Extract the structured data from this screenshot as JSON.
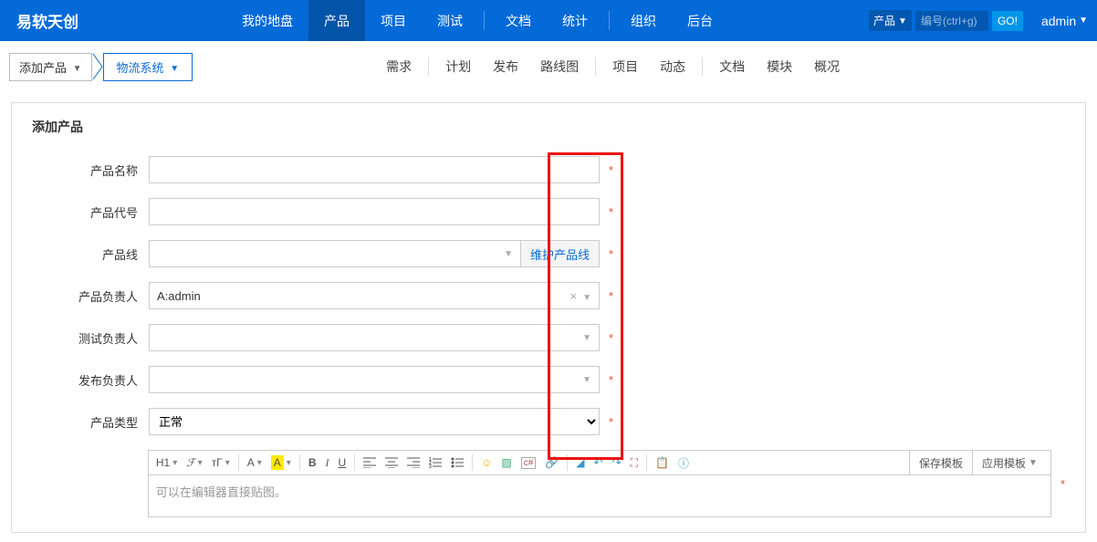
{
  "brand": "易软天创",
  "topnav": {
    "items": [
      {
        "label": "我的地盘",
        "active": false
      },
      {
        "label": "产品",
        "active": true
      },
      {
        "label": "项目",
        "active": false
      },
      {
        "label": "测试",
        "active": false
      },
      {
        "label": "文档",
        "active": false
      },
      {
        "label": "统计",
        "active": false
      },
      {
        "label": "组织",
        "active": false
      },
      {
        "label": "后台",
        "active": false
      }
    ]
  },
  "search": {
    "module_label": "产品",
    "placeholder": "编号(ctrl+g)",
    "go": "GO!"
  },
  "user": "admin",
  "crumb": {
    "add_product": "添加产品",
    "logistics": "物流系统"
  },
  "submenu": [
    "需求",
    "计划",
    "发布",
    "路线图",
    "项目",
    "动态",
    "文档",
    "模块",
    "概况"
  ],
  "panel_title": "添加产品",
  "form": {
    "name": {
      "label": "产品名称",
      "value": ""
    },
    "code": {
      "label": "产品代号",
      "value": ""
    },
    "line": {
      "label": "产品线",
      "value": "",
      "maintain": "维护产品线"
    },
    "po": {
      "label": "产品负责人",
      "value": "A:admin"
    },
    "qa": {
      "label": "测试负责人",
      "value": ""
    },
    "rel": {
      "label": "发布负责人",
      "value": ""
    },
    "type": {
      "label": "产品类型",
      "value": "正常"
    }
  },
  "asterisk": "*",
  "editor": {
    "placeholder": "可以在编辑器直接贴图。",
    "save_tpl": "保存模板",
    "apply_tpl": "应用模板",
    "h1": "H1",
    "font_f": "ℱ",
    "font_t": "тГ"
  }
}
